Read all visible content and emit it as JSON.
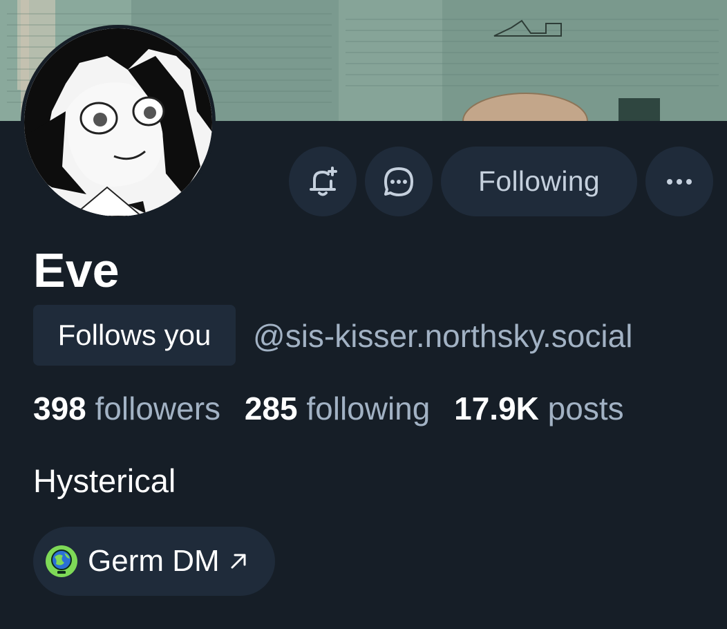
{
  "profile": {
    "display_name": "Eve",
    "follows_you_badge": "Follows you",
    "handle": "@sis-kisser.northsky.social",
    "bio": "Hysterical"
  },
  "stats": {
    "followers_count": "398",
    "followers_label": "followers",
    "following_count": "285",
    "following_label": "following",
    "posts_count": "17.9K",
    "posts_label": "posts"
  },
  "actions": {
    "subscribe_icon": "bell-plus-icon",
    "message_icon": "chat-bubble-icon",
    "following_label": "Following",
    "more_icon": "ellipsis-icon"
  },
  "link": {
    "label": "Germ DM",
    "icon": "globe-icon",
    "arrow_icon": "arrow-up-right-icon"
  },
  "colors": {
    "background": "#161e27",
    "button_bg": "#1f2b3a",
    "muted_text": "#a2b2c4",
    "primary_text": "#ffffff"
  }
}
